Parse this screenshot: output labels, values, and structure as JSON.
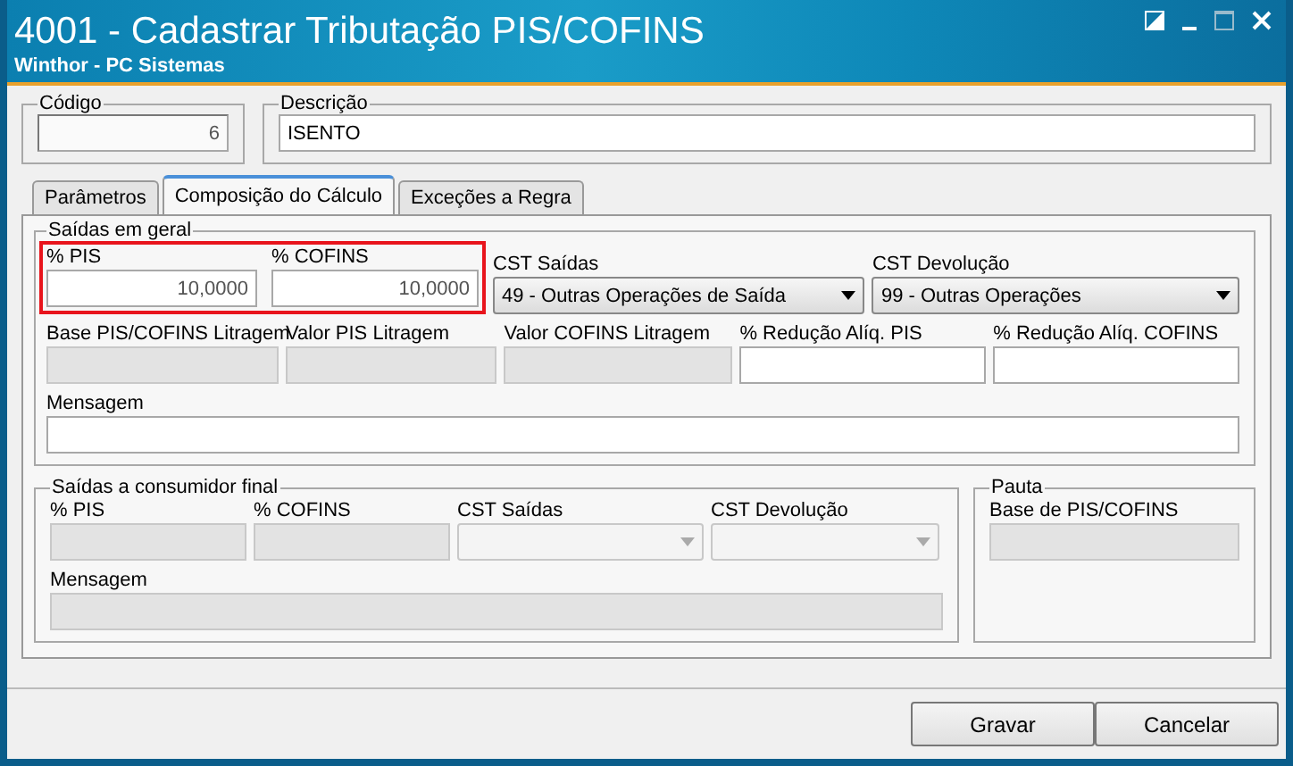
{
  "window": {
    "title": "4001 - Cadastrar Tributação PIS/COFINS",
    "subtitle": "Winthor - PC Sistemas"
  },
  "header": {
    "codigo": {
      "label": "Código",
      "value": "6"
    },
    "descricao": {
      "label": "Descrição",
      "value": "ISENTO"
    }
  },
  "tabs": [
    {
      "label": "Parâmetros",
      "selected": false
    },
    {
      "label": "Composição do Cálculo",
      "selected": true
    },
    {
      "label": "Exceções a Regra",
      "selected": false
    }
  ],
  "saidas_em_geral": {
    "title": "Saídas em geral",
    "highlighted_fields": [
      {
        "label": "% PIS",
        "value": "10,0000",
        "kind": "text",
        "disabled": false
      },
      {
        "label": "% COFINS",
        "value": "10,0000",
        "kind": "text",
        "disabled": false
      }
    ],
    "row_1": [
      {
        "label": "CST Saídas",
        "value": "49 - Outras Operações de Saída",
        "kind": "select",
        "disabled": false
      },
      {
        "label": "CST Devolução",
        "value": "99 - Outras Operações",
        "kind": "select",
        "disabled": false
      }
    ],
    "row_2": [
      {
        "label": "Base PIS/COFINS Litragem",
        "kind": "text",
        "disabled": true
      },
      {
        "label": "Valor PIS Litragem",
        "kind": "text",
        "disabled": true
      },
      {
        "label": "Valor COFINS Litragem",
        "kind": "text",
        "disabled": true
      },
      {
        "label": "% Redução Alíq. PIS",
        "kind": "text",
        "disabled": false
      },
      {
        "label": "% Redução Alíq. COFINS",
        "kind": "text",
        "disabled": false
      }
    ],
    "mensagem": {
      "label": "Mensagem",
      "kind": "text",
      "disabled": false
    }
  },
  "saidas_consumidor_final": {
    "title": "Saídas a consumidor final",
    "row_1": [
      {
        "label": "% PIS",
        "kind": "text",
        "disabled": true
      },
      {
        "label": "% COFINS",
        "kind": "text",
        "disabled": true
      },
      {
        "label": "CST Saídas",
        "kind": "select",
        "disabled": true
      },
      {
        "label": "CST Devolução",
        "kind": "select",
        "disabled": true
      }
    ],
    "mensagem": {
      "label": "Mensagem",
      "kind": "text",
      "disabled": true
    }
  },
  "pauta": {
    "title": "Pauta",
    "field": {
      "label": "Base de PIS/COFINS",
      "kind": "text",
      "disabled": true
    }
  },
  "buttons": [
    "Gravar",
    "Cancelar"
  ]
}
